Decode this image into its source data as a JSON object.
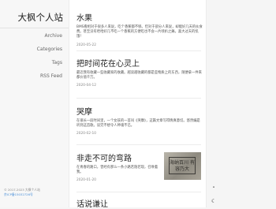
{
  "site": {
    "title": "大枫个人站"
  },
  "nav": [
    {
      "label": "Archive"
    },
    {
      "label": "Categories"
    },
    {
      "label": "Tags"
    },
    {
      "label": "RSS Feed"
    }
  ],
  "footer": {
    "copyright": "© 2017-2023 大枫个人站",
    "record": "京ICP备15032726号"
  },
  "posts": [
    {
      "title": "水果",
      "excerpt": "BMS看相对于很多人来说，吃个香蕉都不够。但对于部分人来说，却能好几天的伙食费。甚至没有哈哈好几不吃一个香蕉的方便吃也不会一片喷扒之痛。喜大过天的饥饿！",
      "date": "2020-05-22"
    },
    {
      "title": "把时间花在心灵上",
      "excerpt": "最近我有收藏一些收藏家的收藏。越读越收藏的都是些物质上的东西，随便拿一件来都价值千万。",
      "date": "2020-04-12"
    },
    {
      "title": "哭摩",
      "excerpt": "在很长一段时间里，一个女孩的一首叫《哭摩》，这篇文章写得情真意切。悠然编是听到这首歌。谈完不想令人神魂不已。",
      "date": "2020-02-10"
    },
    {
      "title": "非走不可的弯路",
      "excerpt": "在青春的路口，曾经有那么一条小路若隐若现，召唤着我。",
      "date": "2020-01-20",
      "image_text": "海纳百川 有容乃大"
    },
    {
      "title": "话说谦让",
      "excerpt": "",
      "date": ""
    }
  ],
  "tools": {
    "top_icon": "chevron-up-icon",
    "theme_icon": "moon-icon",
    "top_glyph": "˄",
    "theme_glyph": "☾"
  }
}
